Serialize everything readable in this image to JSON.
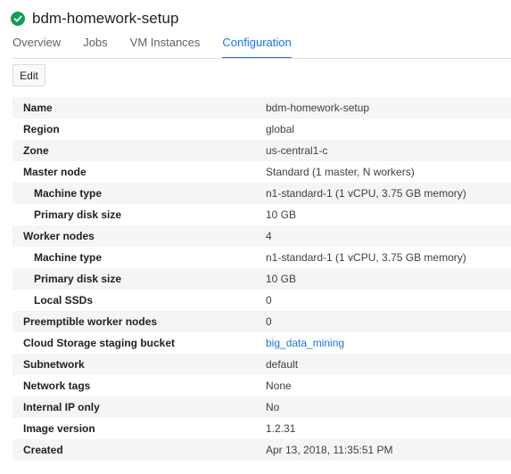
{
  "header": {
    "title": "bdm-homework-setup",
    "status_icon": "check-circle-icon",
    "status_color": "#0f9d58"
  },
  "tabs": [
    {
      "label": "Overview",
      "active": false
    },
    {
      "label": "Jobs",
      "active": false
    },
    {
      "label": "VM Instances",
      "active": false
    },
    {
      "label": "Configuration",
      "active": true
    }
  ],
  "toolbar": {
    "edit_label": "Edit"
  },
  "config": [
    {
      "key": "Name",
      "value": "bdm-homework-setup"
    },
    {
      "key": "Region",
      "value": "global"
    },
    {
      "key": "Zone",
      "value": "us-central1-c"
    },
    {
      "key": "Master node",
      "value": "Standard (1 master, N workers)"
    },
    {
      "key": "Machine type",
      "value": "n1-standard-1 (1 vCPU, 3.75 GB memory)",
      "indent": true
    },
    {
      "key": "Primary disk size",
      "value": "10 GB",
      "indent": true
    },
    {
      "key": "Worker nodes",
      "value": "4"
    },
    {
      "key": "Machine type",
      "value": "n1-standard-1 (1 vCPU, 3.75 GB memory)",
      "indent": true
    },
    {
      "key": "Primary disk size",
      "value": "10 GB",
      "indent": true
    },
    {
      "key": "Local SSDs",
      "value": "0",
      "indent": true
    },
    {
      "key": "Preemptible worker nodes",
      "value": "0"
    },
    {
      "key": "Cloud Storage staging bucket",
      "value": "big_data_mining",
      "link": true
    },
    {
      "key": "Subnetwork",
      "value": "default"
    },
    {
      "key": "Network tags",
      "value": "None"
    },
    {
      "key": "Internal IP only",
      "value": "No"
    },
    {
      "key": "Image version",
      "value": "1.2.31"
    },
    {
      "key": "Created",
      "value": "Apr 13, 2018, 11:35:51 PM"
    }
  ]
}
